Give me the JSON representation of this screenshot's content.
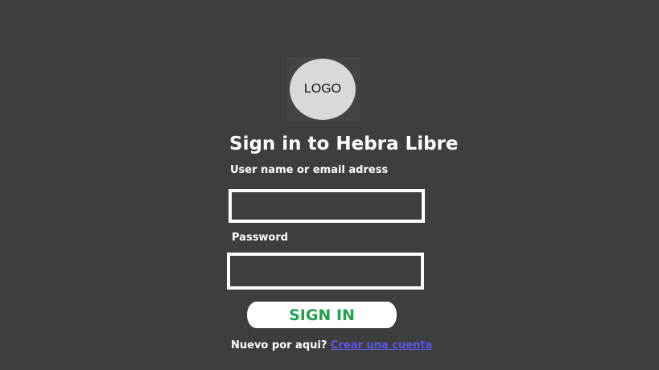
{
  "logo": {
    "text": "LOGO"
  },
  "form": {
    "title": "Sign in to Hebra Libre",
    "username_label": "User name or email adress",
    "username_value": "",
    "password_label": "Password",
    "password_value": "",
    "submit_label": "SIGN IN"
  },
  "footer": {
    "prompt": "Nuevo por aqui?",
    "link_label": "Crear una cuenta"
  },
  "colors": {
    "background": "#3e3e3e",
    "submit_text": "#1fa24a",
    "link": "#5b56e8"
  }
}
